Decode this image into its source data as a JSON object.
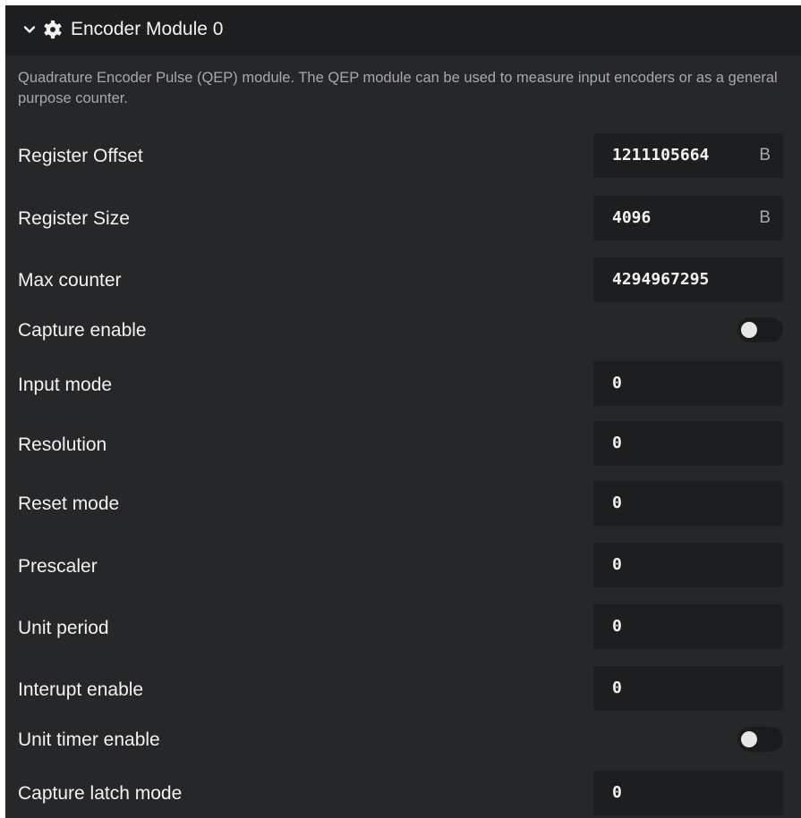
{
  "section": {
    "title": "Encoder Module 0",
    "expanded": true,
    "expand_icon": "chevron-down-icon",
    "module_icon": "gear-icon",
    "description": "Quadrature Encoder Pulse (QEP) module. The QEP module can be used to measure input encoders or as a general purpose counter."
  },
  "fields": [
    {
      "label": "Register Offset",
      "type": "number",
      "value": "1211105664",
      "unit": "B"
    },
    {
      "label": "Register Size",
      "type": "number",
      "value": "4096",
      "unit": "B"
    },
    {
      "label": "Max counter",
      "type": "number",
      "value": "4294967295",
      "unit": ""
    },
    {
      "label": "Capture enable",
      "type": "toggle",
      "checked": false
    },
    {
      "label": "Input mode",
      "type": "number",
      "value": "0",
      "unit": ""
    },
    {
      "label": "Resolution",
      "type": "number",
      "value": "0",
      "unit": ""
    },
    {
      "label": "Reset mode",
      "type": "number",
      "value": "0",
      "unit": ""
    },
    {
      "label": "Prescaler",
      "type": "number",
      "value": "0",
      "unit": ""
    },
    {
      "label": "Unit period",
      "type": "number",
      "value": "0",
      "unit": ""
    },
    {
      "label": "Interupt enable",
      "type": "number",
      "value": "0",
      "unit": ""
    },
    {
      "label": "Unit timer enable",
      "type": "toggle",
      "checked": false
    },
    {
      "label": "Capture latch mode",
      "type": "number",
      "value": "0",
      "unit": ""
    }
  ],
  "colors": {
    "panel_background": "#262729",
    "header_background": "#1d1e20",
    "field_background": "#1d1e20",
    "text": "#f2f2f2",
    "muted_text": "#a7a8ab",
    "toggle_off_track": "#1a1b1d",
    "toggle_knob": "#e6e6e6"
  }
}
